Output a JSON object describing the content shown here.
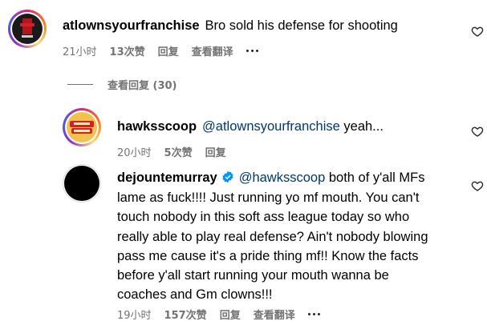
{
  "comments": [
    {
      "username": "atlownsyourfranchise",
      "text": "Bro sold his defense for shooting",
      "time": "21小时",
      "likes": "13次赞",
      "reply_label": "回复",
      "translate_label": "查看翻译",
      "avatar_icon": "avatar-atlownsyourfranchise"
    },
    {
      "username": "hawksscoop",
      "mention": "@atlownsyourfranchise",
      "text": "yeah...",
      "time": "20小时",
      "likes": "5次赞",
      "reply_label": "回复",
      "avatar_icon": "avatar-hawksscoop"
    },
    {
      "username": "dejountemurray",
      "verified": true,
      "mention": "@hawksscoop",
      "lines": [
        "both of y'all MFs",
        "lame as fuck!!!! Just running yo mf mouth. You can't",
        "touch nobody in this soft ass league today so who",
        "really able to play real defense? Ain't nobody blowing",
        "pass me cause it's a pride thing mf!! Know the facts",
        "before y'all start running your mouth wanna be",
        "coaches and Gm clowns!!!"
      ],
      "time": "19小时",
      "likes": "157次赞",
      "reply_label": "回复",
      "translate_label": "查看翻译",
      "avatar_icon": "avatar-dejountemurray"
    }
  ],
  "view_replies": "查看回复 (30)",
  "colors": {
    "mention": "#00376b",
    "meta": "#737373",
    "verified": "#0095f6"
  }
}
